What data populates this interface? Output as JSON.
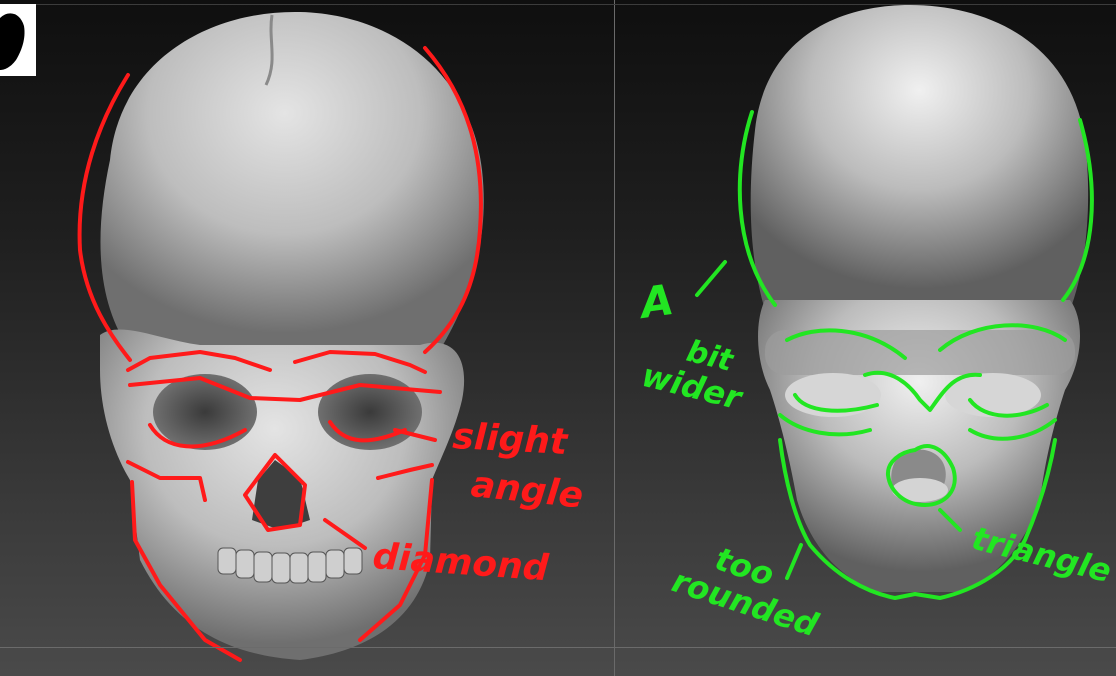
{
  "viewports": {
    "left": {
      "annotation_color": "#ff1a1a"
    },
    "right": {
      "annotation_color": "#22e622"
    }
  },
  "annotations": {
    "slight": "slight",
    "angle": "angle",
    "diamond": "diamond",
    "a": "A",
    "bit": "bit",
    "wider": "wider",
    "too": "too",
    "rounded": "rounded",
    "triangle": "triangle"
  },
  "icons": {
    "thumbnail": "head-silhouette-icon"
  }
}
